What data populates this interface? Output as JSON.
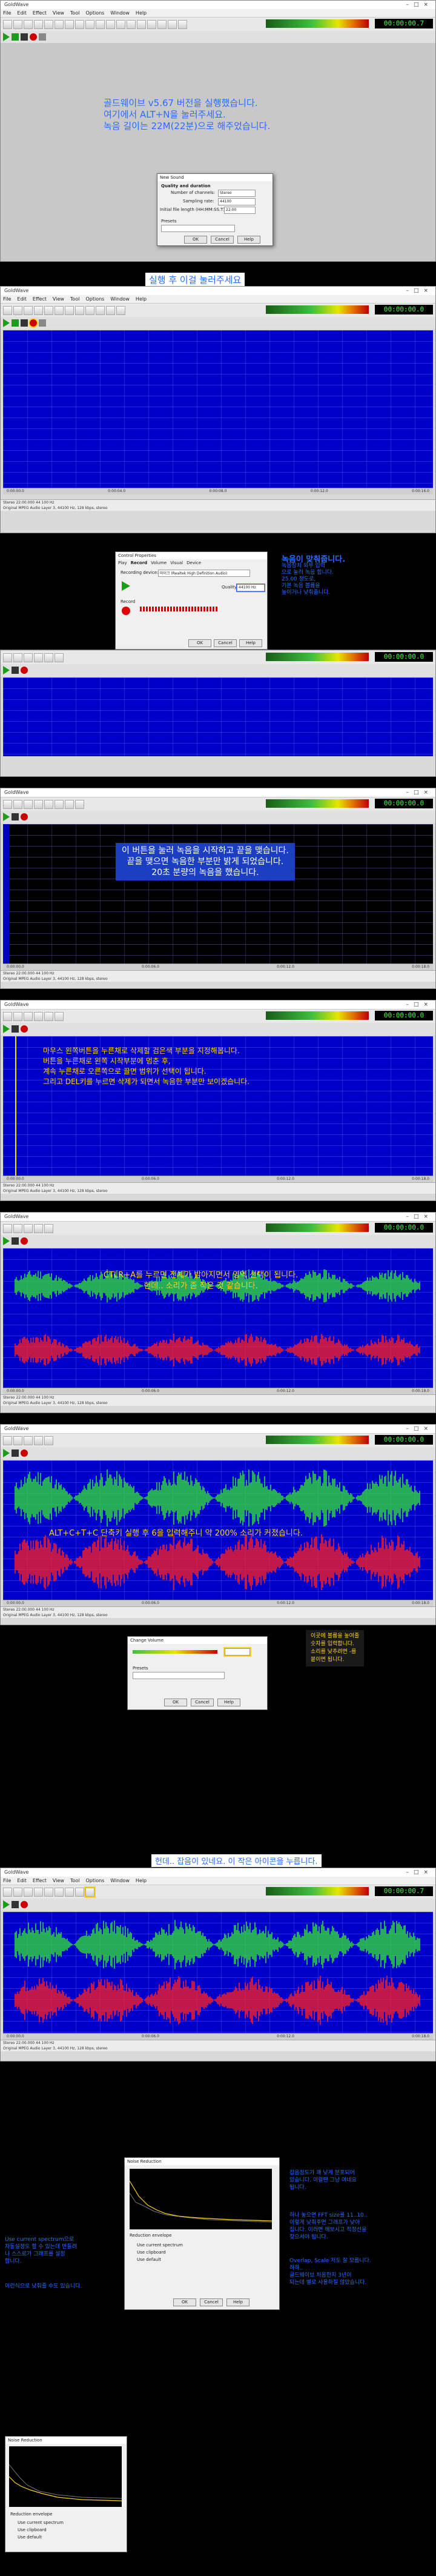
{
  "app": {
    "title": "GoldWave",
    "menus": [
      "File",
      "Edit",
      "Effect",
      "View",
      "Tool",
      "Options",
      "Window",
      "Help"
    ],
    "time_display": "00:00:00.0",
    "time_display_7": "00:00:00.7"
  },
  "section1": {
    "dialog": {
      "title": "New Sound",
      "group_label": "Quality and duration",
      "channels_label": "Number of channels:",
      "channels_value": "Stereo",
      "rate_label": "Sampling rate:",
      "rate_value": "44100",
      "length_label": "Initial file length (HH:MM:SS.T):",
      "length_value": "22:00",
      "presets_label": "Presets",
      "ok": "OK",
      "cancel": "Cancel",
      "help": "Help"
    },
    "note": [
      "골드웨이브 v5.67 버전을 실행했습니다.",
      "여기에서 ALT+N을 눌러주세요.",
      "녹음 길이는 22M(22분)으로 해주었습니다."
    ]
  },
  "section2": {
    "note": "실행 후 이걸 눌러주세요"
  },
  "section3": {
    "dialog": {
      "title": "Control Properties",
      "tabs": [
        "Play",
        "Record",
        "Volume",
        "Visual",
        "Device"
      ],
      "device_label": "Recording device:",
      "device_value": "마이크 (Realtek High Definition Audio)",
      "record_label": "Record",
      "quality_label": "Quality:",
      "quality_value": "44100 Hz",
      "ok": "OK",
      "cancel": "Cancel",
      "help": "Help"
    },
    "note": [
      "녹음이 맞춰줍니다.",
      "녹음장치 외부 입력",
      "으로 눌러 녹음 합니다.",
      "25.00 정도로,",
      "기본 녹음 볼륨을",
      "높이거나 낮춰줍니다."
    ],
    "note_title": "녹음이 맞춰줍니다."
  },
  "section4": {
    "note": [
      "이 버튼을 눌러 녹음을 시작하고 끝을 맺습니다.",
      "끝을 맺으면 녹음한 부분만 밝게 되었습니다.",
      "20초 분량의 녹음을 했습니다."
    ]
  },
  "section5": {
    "note": [
      "마우스 왼쪽버튼을 누른채로 삭제할 검은색 부분을 지정해봅니다.",
      "버튼을 누른채로 왼쪽 시작부분에 멈춘 후,",
      "계속 누른채로 오른쪽으로 끌면 범위가 선택이 됩니다.",
      "그리고 DEL키를 누르면 삭제가 되면서 녹음한 부분만 보이겠습니다."
    ]
  },
  "section6": {
    "note": [
      "CTLR+A를 누르면 전체가 밝아지면서 영역 선택이 됩니다.",
      "헌데.. 소리가 좀 작은 것 같습니다."
    ]
  },
  "section7": {
    "note": "ALT+C+T+C 단축키 실행 후 6을 입력해주니 약 200% 소리가 커졌습니다.",
    "dialog": {
      "title": "Change Volume",
      "ok": "OK",
      "cancel": "Cancel",
      "help": "Help",
      "presets_label": "Presets"
    },
    "side_note": [
      "이곳에 볼륨을 높여줄",
      "숫자를 입력합니다.",
      "소리를 낮추려면 -를",
      "붙이면 됩니다."
    ]
  },
  "section8": {
    "note": "헌데.. 잡음이 있네요. 이 작은 아이콘을 누릅니다."
  },
  "section9": {
    "dialog": {
      "title": "Noise Reduction",
      "ok": "OK",
      "cancel": "Cancel",
      "help": "Help",
      "reduction_label": "Reduction envelope",
      "options": [
        "Use current spectrum",
        "Use clipboard",
        "Use default"
      ]
    },
    "right_note": [
      "잡음정도가 꽤 낮게 분포되어",
      "있습니다. 이럴땐 그냥 여네요",
      "됩니다."
    ],
    "right_note2": [
      "하나 놓으면 FFT size를 11..10..",
      "이렇게 낮춰주면 그래프가 낮아",
      "집니다. 이러면 해보시고 적정선을",
      "찾으셔야 됩니다."
    ],
    "right_note3": [
      "Overlap, Scale 저도 잘 모릅니다.",
      "하하..",
      "골드웨이브 처음한지 3년이",
      "되는데 별로 사용하질 않았습니다."
    ],
    "left_note": [
      "Use current spectrum으로",
      "자동설정도 할 수 있는데 만들려",
      "나 스스로가 그래프를 설정",
      "합니다."
    ],
    "left_note2": "이런식으로 낮춰줄 수도 있습니다."
  },
  "ruler_labels": [
    "0:00:00.0",
    "0:00:02.0",
    "0:00:04.0",
    "0:00:06.0",
    "0:00:08.0",
    "0:00:10.0",
    "0:00:12.0",
    "0:00:14.0",
    "0:00:16.0",
    "0:00:18.0"
  ],
  "status": {
    "line1": "Stereo    22:00.000    44 100 Hz",
    "line2": "Original  MPEG Audio Layer 3, 44100 Hz, 128 kbps, stereo"
  },
  "colors": {
    "accent_note": "#2b6cff",
    "yellow_text": "#ffd21f",
    "wave_left": "#33e633",
    "wave_right": "#ff2020",
    "wave_bg": "#0000c8"
  }
}
